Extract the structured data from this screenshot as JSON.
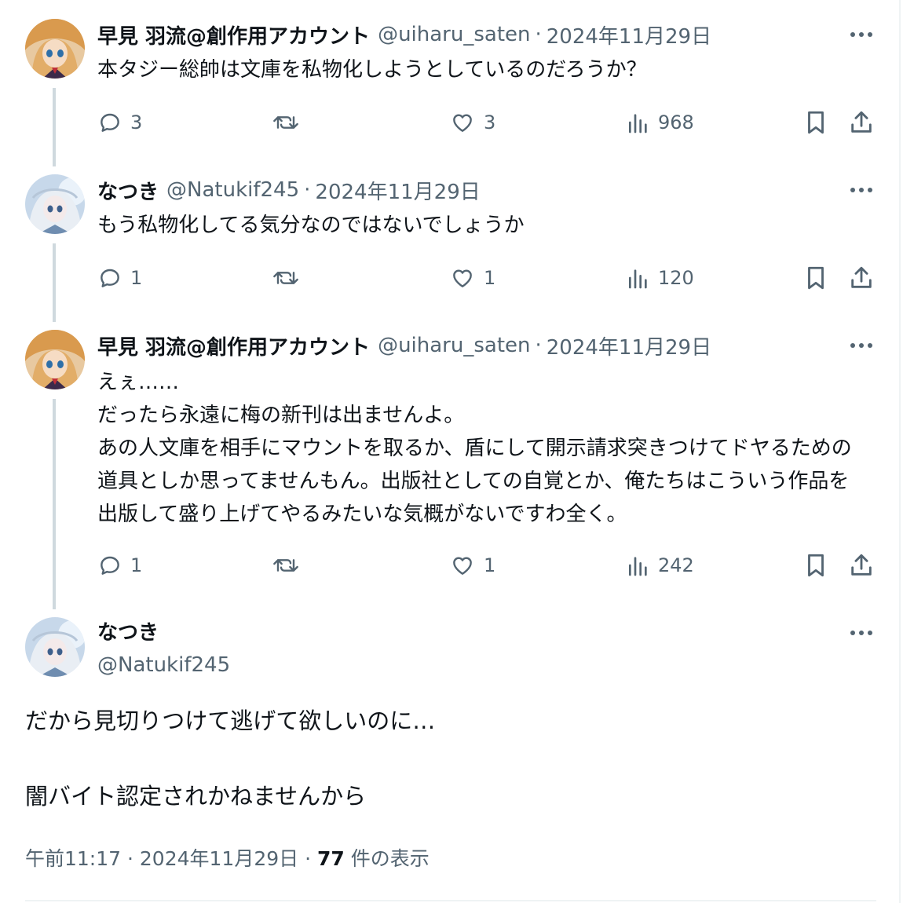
{
  "replies": [
    {
      "display_name": "早見 羽流@創作用アカウント",
      "handle": "@uiharu_saten",
      "separator": "·",
      "date": "2024年11月29日",
      "lines": [
        "本タジー総帥は文庫を私物化しようとしているのだろうか？"
      ],
      "reply_count": "3",
      "like_count": "3",
      "view_count": "968"
    },
    {
      "display_name": "なつき",
      "handle": "@Natukif245",
      "separator": "·",
      "date": "2024年11月29日",
      "lines": [
        "もう私物化してる気分なのではないでしょうか"
      ],
      "reply_count": "1",
      "like_count": "1",
      "view_count": "120"
    },
    {
      "display_name": "早見 羽流@創作用アカウント",
      "handle": "@uiharu_saten",
      "separator": "·",
      "date": "2024年11月29日",
      "lines": [
        "えぇ……",
        "だったら永遠に梅の新刊は出ませんよ。",
        "あの人文庫を相手にマウントを取るか、盾にして開示請求突きつけてドヤるための",
        "道具としか思ってませんもん。出版社としての自覚とか、俺たちはこういう作品を",
        "出版して盛り上げてやるみたいな気概がないですわ全く。"
      ],
      "reply_count": "1",
      "like_count": "1",
      "view_count": "242"
    }
  ],
  "main_tweet": {
    "display_name": "なつき",
    "handle": "@Natukif245",
    "text_line_1": "だから見切りつけて逃げて欲しいのに…",
    "text_line_2": "闇バイト認定されかねませんから",
    "time": "午前11:17",
    "separator": "·",
    "date": "2024年11月29日",
    "views_count": "77",
    "views_label": "件の表示"
  },
  "icons": {
    "reply": "reply-icon",
    "retweet": "retweet-icon",
    "like": "like-icon",
    "views": "views-icon",
    "bookmark": "bookmark-icon",
    "share": "share-icon",
    "more": "more-icon"
  },
  "colors": {
    "text": "#0f1419",
    "secondary": "#536471",
    "thread_line": "#cfd9de",
    "border": "#eff3f4"
  }
}
